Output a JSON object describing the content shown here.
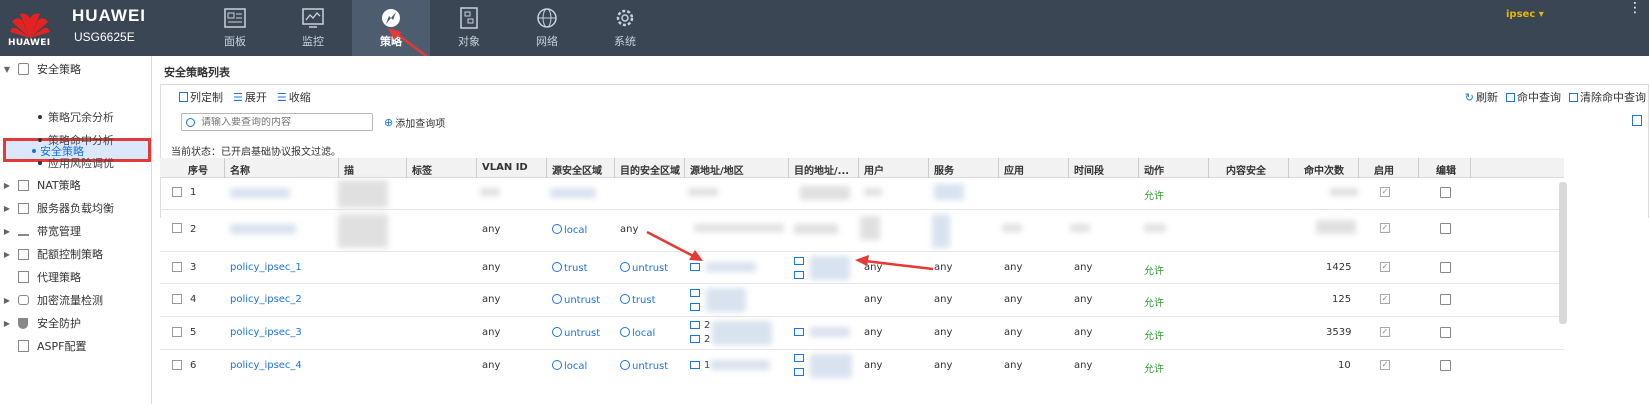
{
  "header": {
    "brand": "HUAWEI",
    "model": "USG6625E",
    "logo_text": "HUAWEI",
    "user": "ipsec",
    "more": "⋮",
    "nav": [
      {
        "label": "面板",
        "icon": "dashboard-icon"
      },
      {
        "label": "监控",
        "icon": "monitor-icon"
      },
      {
        "label": "策略",
        "icon": "compass-icon",
        "active": true
      },
      {
        "label": "对象",
        "icon": "object-icon"
      },
      {
        "label": "网络",
        "icon": "globe-icon"
      },
      {
        "label": "系统",
        "icon": "gear-icon"
      }
    ]
  },
  "sidebar": {
    "items": [
      {
        "label": "安全策略",
        "expanded": true
      },
      {
        "label": "安全策略",
        "sub": true,
        "active": true
      },
      {
        "label": "策略冗余分析",
        "sub": true
      },
      {
        "label": "策略命中分析",
        "sub": true
      },
      {
        "label": "应用风险调优",
        "sub": true
      },
      {
        "label": "NAT策略"
      },
      {
        "label": "服务器负载均衡"
      },
      {
        "label": "带宽管理"
      },
      {
        "label": "配额控制策略"
      },
      {
        "label": "代理策略"
      },
      {
        "label": "加密流量检测"
      },
      {
        "label": "安全防护"
      },
      {
        "label": "ASPF配置"
      }
    ]
  },
  "main": {
    "title": "安全策略列表",
    "toolbar": {
      "customize": "列定制",
      "expand": "展开",
      "collapse": "收缩",
      "refresh": "刷新",
      "hit_query": "命中查询",
      "clear_hit": "清除命中查询"
    },
    "search_placeholder": "请输入要查询的内容",
    "add_query": "添加查询项",
    "status": "当前状态：已开启基础协议报文过滤。",
    "columns": [
      "序号",
      "名称",
      "描",
      "标签",
      "VLAN ID",
      "源安全区域",
      "目的安全区域",
      "源地址/地区",
      "目的地址/...",
      "用户",
      "服务",
      "应用",
      "时间段",
      "动作",
      "内容安全",
      "命中次数",
      "启用",
      "编辑"
    ],
    "rows": [
      {
        "no": "1",
        "name": "",
        "vlan": "",
        "src_zone": "",
        "dst_zone": "",
        "user": "",
        "service": "",
        "app": "",
        "time": "",
        "action": "允许",
        "hits": ""
      },
      {
        "no": "2",
        "name": "",
        "vlan": "any",
        "src_zone": "local",
        "dst_zone": "any",
        "user": "",
        "service": "",
        "app": "",
        "time": "",
        "action": "",
        "hits": ""
      },
      {
        "no": "3",
        "name": "policy_ipsec_1",
        "vlan": "any",
        "src_zone": "trust",
        "dst_zone": "untrust",
        "user": "any",
        "service": "any",
        "app": "any",
        "time": "any",
        "action": "允许",
        "hits": "1425"
      },
      {
        "no": "4",
        "name": "policy_ipsec_2",
        "vlan": "any",
        "src_zone": "untrust",
        "dst_zone": "trust",
        "user": "any",
        "service": "any",
        "app": "any",
        "time": "any",
        "action": "允许",
        "hits": "125"
      },
      {
        "no": "5",
        "name": "policy_ipsec_3",
        "vlan": "any",
        "src_zone": "untrust",
        "dst_zone": "local",
        "src_addr": "2",
        "user": "any",
        "service": "any",
        "app": "any",
        "time": "any",
        "action": "允许",
        "hits": "3539"
      },
      {
        "no": "6",
        "name": "policy_ipsec_4",
        "vlan": "any",
        "src_zone": "local",
        "dst_zone": "untrust",
        "src_addr": "1",
        "user": "any",
        "service": "any",
        "app": "any",
        "time": "any",
        "action": "允许",
        "hits": "10"
      }
    ]
  },
  "colors": {
    "topbar": "#3a4654",
    "accent": "#1a73e8",
    "allow": "#2e9d2e",
    "highlight": "#e53935"
  }
}
